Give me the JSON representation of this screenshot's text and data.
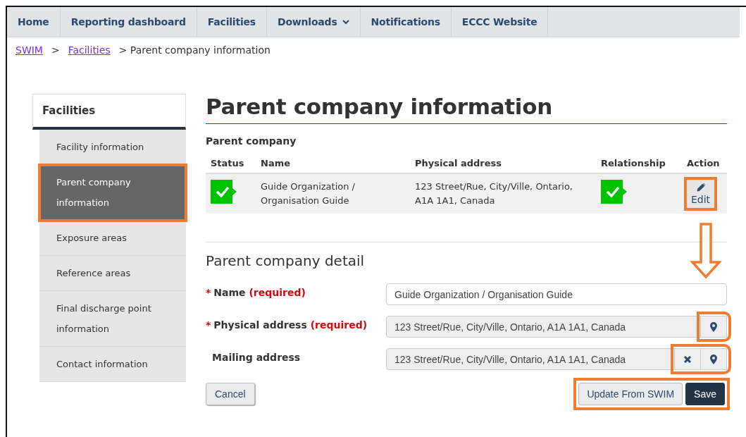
{
  "nav": {
    "items": [
      {
        "label": "Home",
        "dropdown": false
      },
      {
        "label": "Reporting dashboard",
        "dropdown": false
      },
      {
        "label": "Facilities",
        "dropdown": false
      },
      {
        "label": "Downloads",
        "dropdown": true
      },
      {
        "label": "Notifications",
        "dropdown": false
      },
      {
        "label": "ECCC Website",
        "dropdown": false
      }
    ]
  },
  "breadcrumb": {
    "links": [
      "SWIM",
      "Facilities"
    ],
    "separator": ">",
    "current": "> Parent company information"
  },
  "sidebar": {
    "title": "Facilities",
    "items": [
      {
        "label": "Facility information",
        "selected": false,
        "highlighted": false
      },
      {
        "label": "Parent company information",
        "selected": true,
        "highlighted": true
      },
      {
        "label": "Exposure areas",
        "selected": false,
        "highlighted": false
      },
      {
        "label": "Reference areas",
        "selected": false,
        "highlighted": false
      },
      {
        "label": "Final discharge point information",
        "selected": false,
        "highlighted": false
      },
      {
        "label": "Contact information",
        "selected": false,
        "highlighted": false
      }
    ]
  },
  "page": {
    "title": "Parent company information"
  },
  "parent_company": {
    "heading": "Parent company",
    "columns": [
      "Status",
      "Name",
      "Physical address",
      "Relationship",
      "Action"
    ],
    "rows": [
      {
        "status_ok": true,
        "name": "Guide Organization / Organisation Guide",
        "address": "123 Street/Rue, City/Ville, Ontario, A1A 1A1, Canada",
        "relationship_ok": true,
        "action": "Edit",
        "action_highlighted": true
      }
    ]
  },
  "detail": {
    "heading": "Parent company detail",
    "fields": [
      {
        "marker": "*",
        "label": "Name",
        "required_text": "(required)",
        "value": "Guide Organization  /  Organisation Guide",
        "readonly": false
      },
      {
        "marker": "*",
        "label": "Physical address",
        "required_text": "(required)",
        "value": "123 Street/Rue, City/Ville, Ontario, A1A 1A1, Canada",
        "readonly": true,
        "locate": true
      },
      {
        "label": "Mailing address",
        "value": "123 Street/Rue, City/Ville, Ontario, A1A 1A1, Canada",
        "readonly": true,
        "clear": true,
        "locate": true
      }
    ],
    "locate_highlighted": true,
    "cancel": "Cancel",
    "actions": [
      {
        "label": "Update From SWIM",
        "kind": "secondary"
      },
      {
        "label": "Save",
        "kind": "primary"
      }
    ],
    "actions_highlighted": true
  }
}
